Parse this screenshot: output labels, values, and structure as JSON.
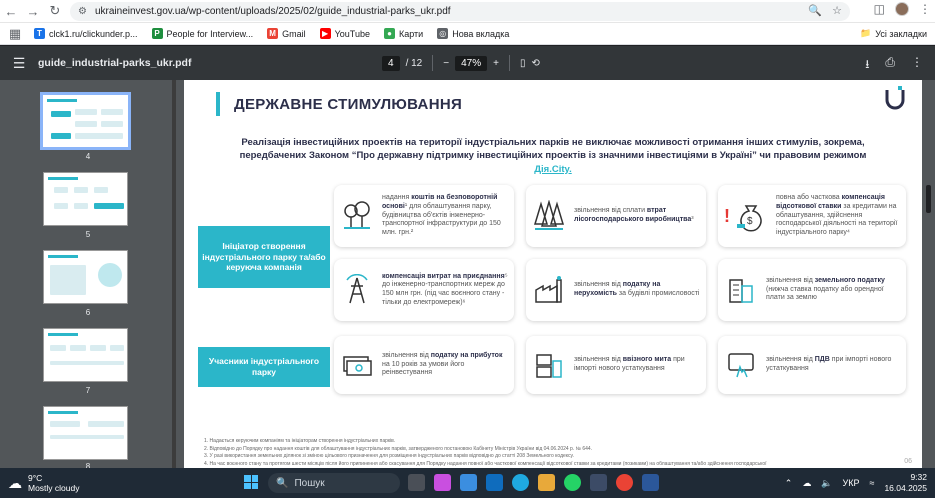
{
  "browser": {
    "url": "ukraineinvest.gov.ua/wp-content/uploads/2025/02/guide_industrial-parks_ukr.pdf",
    "bookmarks": [
      {
        "label": "clck1.ru/clickunder.p...",
        "color": "#1a73e8",
        "glyph": "T"
      },
      {
        "label": "People for Interview...",
        "color": "#1e8e3e",
        "glyph": "P"
      },
      {
        "label": "Gmail",
        "color": "#ea4335",
        "glyph": "M"
      },
      {
        "label": "YouTube",
        "color": "#ff0000",
        "glyph": "▶"
      },
      {
        "label": "Карти",
        "color": "#34a853",
        "glyph": "●"
      },
      {
        "label": "Нова вкладка",
        "color": "#5f6368",
        "glyph": "◎"
      }
    ],
    "all_bookmarks": "Усі закладки"
  },
  "pdf_toolbar": {
    "filename": "guide_industrial-parks_ukr.pdf",
    "page_current": "4",
    "page_total": "/ 12",
    "zoom": "47%"
  },
  "thumbnails": [
    {
      "label": "4"
    },
    {
      "label": "5"
    },
    {
      "label": "6"
    },
    {
      "label": "7"
    },
    {
      "label": "8"
    }
  ],
  "page": {
    "title": "ДЕРЖАВНЕ СТИМУЛЮВАННЯ",
    "intro": "Реалізація інвестиційних проектів на території індустріальних парків не виключає можливості отримання інших стимулів, зокрема, передбачених Законом “Про державну підтримку інвестиційних проектів із значними інвестиціями в Україні” чи правовим режимом",
    "intro_link": "Дія.City.",
    "group1": "Ініціатор створення індустріального парку та/або керуюча компанія",
    "group2": "Учасники індустріального парку",
    "cards": [
      {
        "pre": "надання ",
        "bold": "коштів на безповоротній основі",
        "post": "¹ для облаштування парку, будівництва об'єктів інженерно-транспортної інфраструктури до 150 млн. грн.²"
      },
      {
        "pre": "звільнення від сплати ",
        "bold": "втрат лісогосподарського виробництва",
        "post": "³"
      },
      {
        "pre": "повна або часткова ",
        "bold": "компенсація відсоткової ставки",
        "post": " за кредитами на облаштування, здійснення господарської діяльності на території індустріального парку⁴"
      },
      {
        "pre": "",
        "bold": "компенсація витрат на приєднання",
        "post": "⁵ до інженерно-транспортних мереж до 150 млн грн. (під час воєнного стану - тільки до електромереж)⁶"
      },
      {
        "pre": "звільнення від ",
        "bold": "податку на нерухомість",
        "post": " за будівлі промисловості"
      },
      {
        "pre": "звільнення від ",
        "bold": "земельного податку",
        "post": " (нижча ставка податку або орендної плати за землю"
      },
      {
        "pre": "звільнення від ",
        "bold": "податку на прибуток",
        "post": " на 10 років за умови його реінвестування"
      },
      {
        "pre": "звільнення від ",
        "bold": "ввізного мита",
        "post": " при імпорті нового устаткування"
      },
      {
        "pre": "звільнення від ",
        "bold": "ПДВ",
        "post": " при імпорті нового устаткування"
      }
    ],
    "footnotes": [
      "1. Надається керуючим компаніям та ініціаторам створення індустріальних парків.",
      "2. Відповідно до Порядку про надання коштів для облаштування індустріальних парків, затвердженого постановою Кабінету Міністрів України від 04.06.2024 р. № 644.",
      "3. У разі використання земельних ділянок зі зміною цільового призначення для розміщення індустріальних парків відповідно до статті 208 Земельного кодексу.",
      "4. На час воєнного стану та протягом шести місяців після його припинення або скасування для Порядку надання повної або часткової компенсації відсоткової ставки за кредитами (позиками) на облаштування та/або здійснення господарської"
    ],
    "page_number": "06"
  },
  "taskbar": {
    "temperature": "9°C",
    "weather": "Mostly cloudy",
    "search_placeholder": "Пошук",
    "lang": "УКР",
    "time": "9:32",
    "date": "16.04.2025"
  }
}
